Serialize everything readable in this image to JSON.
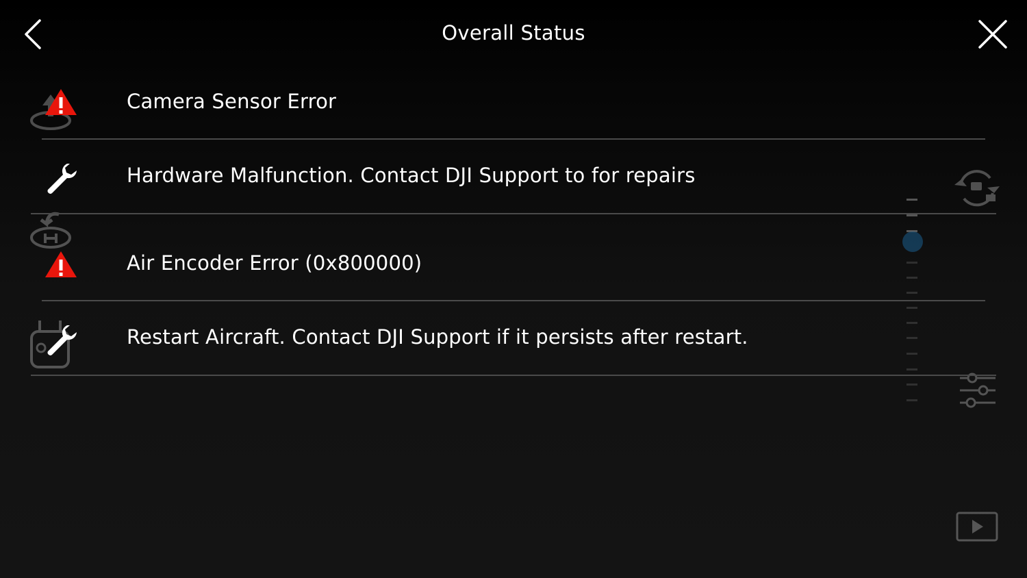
{
  "header": {
    "title": "Overall Status",
    "back_icon": "chevron-left-icon",
    "close_icon": "close-icon"
  },
  "items": [
    {
      "icon": "warning-triangle-icon",
      "text": "Camera Sensor Error"
    },
    {
      "icon": "wrench-icon",
      "text": "Hardware Malfunction. Contact DJI Support to for repairs"
    },
    {
      "icon": "warning-triangle-icon",
      "text": "Air Encoder Error (0x800000)"
    },
    {
      "icon": "wrench-icon",
      "text": "Restart Aircraft. Contact DJI Support if it persists after restart."
    }
  ],
  "colors": {
    "background": "#101010",
    "warning": "#e8160c",
    "text": "#ffffff",
    "divider": "#4a4a4a",
    "slider_knob": "#1d6fa8"
  }
}
